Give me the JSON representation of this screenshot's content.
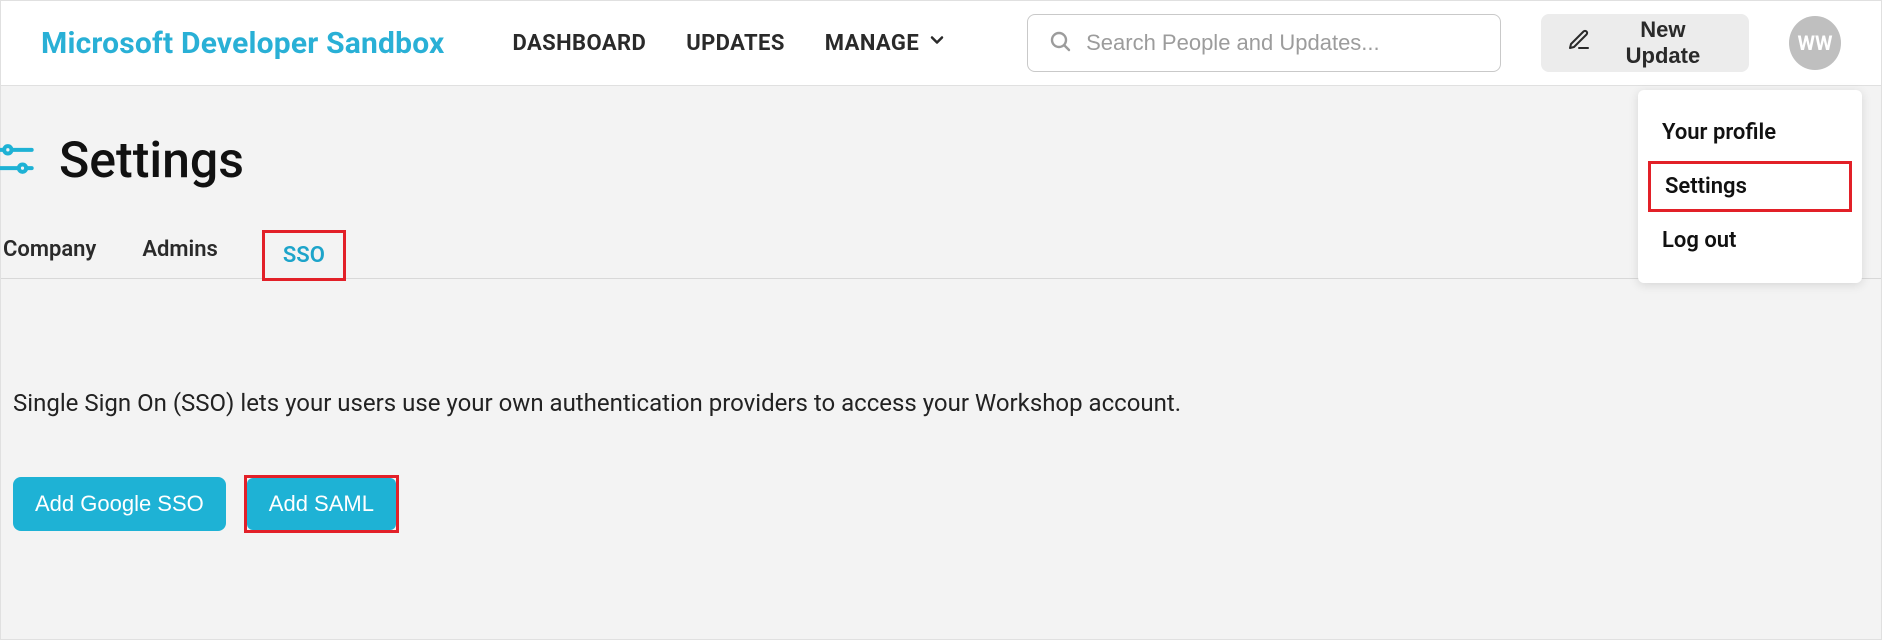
{
  "brand": "Microsoft Developer Sandbox",
  "nav": {
    "dashboard": "DASHBOARD",
    "updates": "UPDATES",
    "manage": "MANAGE"
  },
  "search": {
    "placeholder": "Search People and Updates..."
  },
  "new_update_label": "New Update",
  "avatar_initials": "WW",
  "dropdown": {
    "profile": "Your profile",
    "settings": "Settings",
    "logout": "Log out"
  },
  "page": {
    "title": "Settings",
    "tabs": {
      "company": "Company",
      "admins": "Admins",
      "sso": "SSO"
    },
    "sso_description": "Single Sign On (SSO) lets your users use your own authentication providers to access your Workshop account.",
    "buttons": {
      "add_google": "Add Google SSO",
      "add_saml": "Add SAML"
    }
  },
  "colors": {
    "accent": "#1eb2d5",
    "highlight": "#e22028"
  }
}
